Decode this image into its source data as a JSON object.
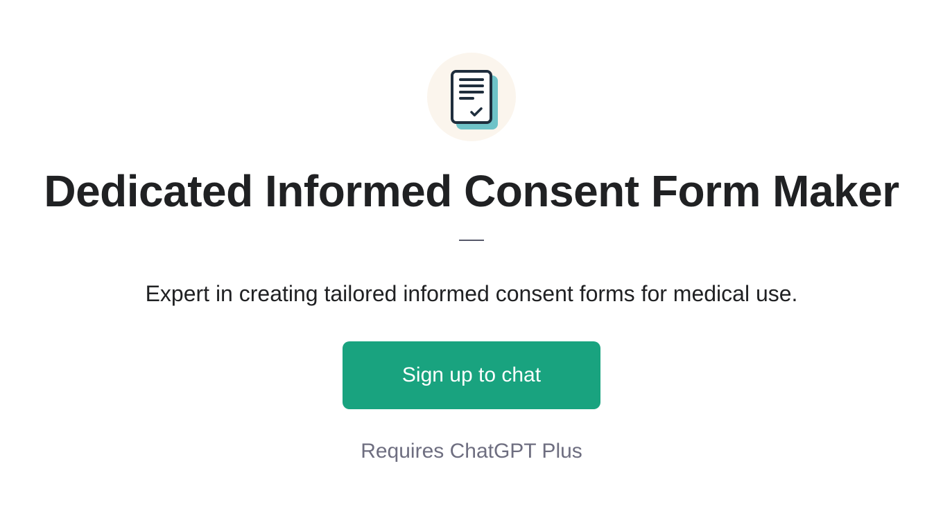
{
  "header": {
    "title": "Dedicated Informed Consent Form Maker",
    "description": "Expert in creating tailored informed consent forms for medical use."
  },
  "action": {
    "signup_label": "Sign up to chat",
    "requires_text": "Requires ChatGPT Plus"
  }
}
